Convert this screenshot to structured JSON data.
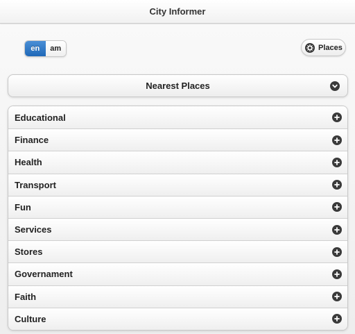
{
  "header": {
    "title": "City Informer"
  },
  "language": {
    "options": [
      {
        "label": "en",
        "active": true
      },
      {
        "label": "am",
        "active": false
      }
    ]
  },
  "places_button": {
    "label": "Places",
    "icon": "gear-icon"
  },
  "nearest": {
    "label": "Nearest Places",
    "icon": "chevron-down-icon"
  },
  "categories": [
    {
      "label": "Educational",
      "icon": "plus-icon"
    },
    {
      "label": "Finance",
      "icon": "plus-icon"
    },
    {
      "label": "Health",
      "icon": "plus-icon"
    },
    {
      "label": "Transport",
      "icon": "plus-icon"
    },
    {
      "label": "Fun",
      "icon": "plus-icon"
    },
    {
      "label": "Services",
      "icon": "plus-icon"
    },
    {
      "label": "Stores",
      "icon": "plus-icon"
    },
    {
      "label": "Governament",
      "icon": "plus-icon"
    },
    {
      "label": "Faith",
      "icon": "plus-icon"
    },
    {
      "label": "Culture",
      "icon": "plus-icon"
    }
  ],
  "colors": {
    "accent": "#1f68b8",
    "icon": "#3a3a3a"
  }
}
